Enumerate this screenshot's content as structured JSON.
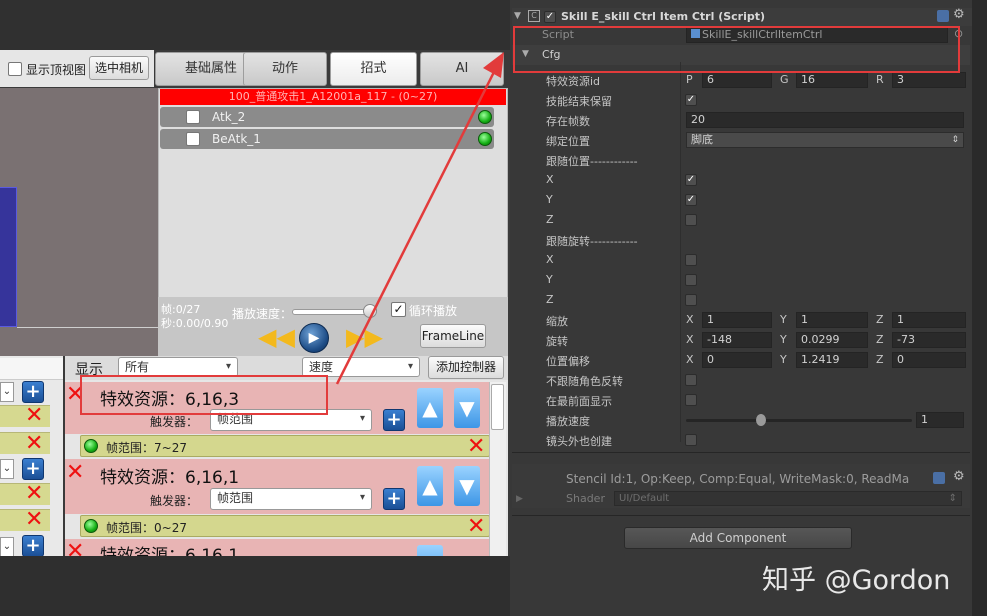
{
  "left_editor": {
    "show_topview_label": "显示顶视图",
    "select_camera_label": "选中相机",
    "tabs": [
      "基础属性",
      "动作",
      "招式",
      "AI"
    ],
    "clip_header": "100_普通攻击1_A12001a_117 - (0~27)",
    "tracks": [
      "Atk_2",
      "BeAtk_1"
    ],
    "frame_info": [
      "帧:0/27",
      "秒:0.00/0.90"
    ],
    "playback_speed_label": "播放速度：",
    "loop_label": "循环播放",
    "frameline_label": "FrameLine",
    "display_label": "显示",
    "display_filter": "所有",
    "speed_dropdown": "速度",
    "add_controller_label": "添加控制器",
    "trigger_label": "触发器：",
    "entries": [
      {
        "title": "特效资源：6,16,3",
        "trigger": "帧范围",
        "range": "帧范围：7~27"
      },
      {
        "title": "特效资源：6,16,1",
        "trigger": "帧范围",
        "range": "帧范围：0~27"
      },
      {
        "title": "特效资源：6,16,1"
      }
    ]
  },
  "inspector": {
    "component_title": "Skill E_skill Ctrl Item Ctrl (Script)",
    "script_label": "Script",
    "script_value": "SkillE_skillCtrlItemCtrl",
    "cfg_label": "Cfg",
    "rows": [
      {
        "label": "特效资源id",
        "xyz": [
          [
            "P",
            "6"
          ],
          [
            "G",
            "16"
          ],
          [
            "R",
            "3"
          ]
        ]
      },
      {
        "label": "技能结束保留",
        "check": true
      },
      {
        "label": "存在帧数",
        "value": "20"
      },
      {
        "label": "绑定位置",
        "dropdown": "脚底"
      },
      {
        "label": "跟随位置------------"
      },
      {
        "label": "X",
        "check": true
      },
      {
        "label": "Y",
        "check": true
      },
      {
        "label": "Z",
        "check": false
      },
      {
        "label": "跟随旋转------------"
      },
      {
        "label": "X",
        "check": false
      },
      {
        "label": "Y",
        "check": false
      },
      {
        "label": "Z",
        "check": false
      },
      {
        "label": "缩放",
        "xyz": [
          [
            "X",
            "1"
          ],
          [
            "Y",
            "1"
          ],
          [
            "Z",
            "1"
          ]
        ]
      },
      {
        "label": "旋转",
        "xyz": [
          [
            "X",
            "-148"
          ],
          [
            "Y",
            "0.0299"
          ],
          [
            "Z",
            "-73"
          ]
        ]
      },
      {
        "label": "位置偏移",
        "xyz": [
          [
            "X",
            "0"
          ],
          [
            "Y",
            "1.2419"
          ],
          [
            "Z",
            "0"
          ]
        ]
      },
      {
        "label": "不跟随角色反转",
        "check": false
      },
      {
        "label": "在最前面显示",
        "check": false
      },
      {
        "label": "播放速度",
        "slider_value": "1"
      },
      {
        "label": "镜头外也创建",
        "check": false
      }
    ],
    "stencil_text": "Stencil Id:1, Op:Keep, Comp:Equal, WriteMask:0, ReadMa",
    "shader_label": "Shader",
    "shader_value": "UI/Default",
    "add_component_label": "Add Component"
  },
  "watermark": "知乎 @Gordon",
  "colors": {
    "highlight": "#e23b3b",
    "red_header": "#ff0000",
    "entry_bg": "#e8b4b4",
    "range_bg": "#d4d78e"
  }
}
